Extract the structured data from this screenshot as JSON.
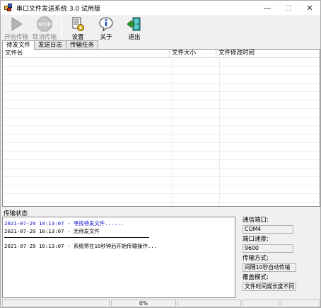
{
  "window": {
    "title": "串口文件发送系统 3.0 试用版",
    "buttons": {
      "minimize": "—",
      "maximize": "☐",
      "close": "✕"
    }
  },
  "toolbar": {
    "start_label": "开始传输",
    "stop_label": "取消传输",
    "settings_label": "设置",
    "about_label": "关于",
    "exit_label": "退出",
    "stop_icon_text": "STOP"
  },
  "tabs": [
    "待发文件",
    "发送日志",
    "传输任务"
  ],
  "file_table": {
    "columns": [
      "文件名",
      "文件大小",
      "文件修改时间"
    ]
  },
  "status": {
    "group_title": "传输状态",
    "log": [
      {
        "text": "2021-07-29 10:13:07 - 寻找待发文件......",
        "color": "#1010d0"
      },
      {
        "text": "2021-07-29 10:13:07 - 无待发文件",
        "color": "#000000"
      },
      {
        "text": "2021-07-29 10:13:07 - 系统将在10秒钟后开始传输操作...",
        "color": "#000000"
      }
    ],
    "port_label": "通信端口:",
    "port_value": "COM4",
    "baud_label": "端口速度:",
    "baud_value": "9600",
    "mode_label": "传输方式:",
    "mode_value": "间隔10秒自动传输",
    "overwrite_label": "覆盖模式:",
    "overwrite_value": "文件时间或长度不同"
  },
  "statusbar": {
    "progress": "0%"
  },
  "colors": {
    "log_blue": "#1010d0",
    "stop_red": "#c8c8c8"
  }
}
